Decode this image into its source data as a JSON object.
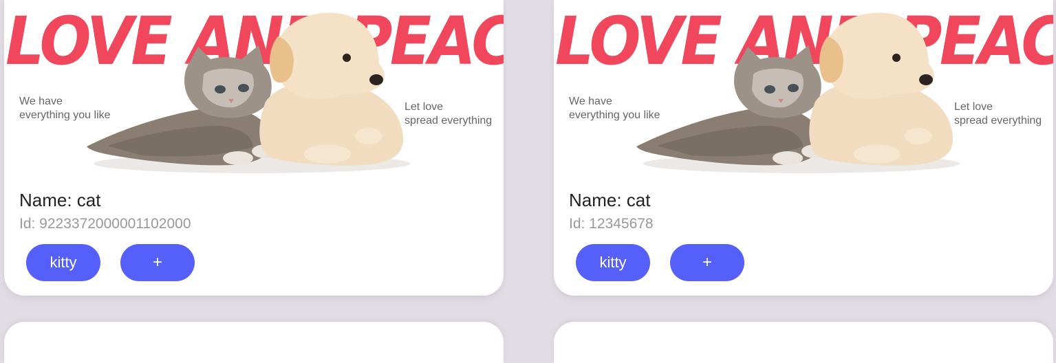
{
  "cards": [
    {
      "banner": {
        "headline": "LOVE AND PEACE",
        "caption_left_1": "We have",
        "caption_left_2": "everything you like",
        "caption_right_1": "Let love",
        "caption_right_2": "spread everything"
      },
      "name": "Name: cat",
      "id": "Id: 9223372000001102000",
      "tag_label": "kitty",
      "add_label": "+"
    },
    {
      "banner": {
        "headline": "LOVE AND PEACE",
        "caption_left_1": "We have",
        "caption_left_2": "everything you like",
        "caption_right_1": "Let love",
        "caption_right_2": "spread everything"
      },
      "name": "Name: cat",
      "id": "Id: 12345678",
      "tag_label": "kitty",
      "add_label": "+"
    }
  ],
  "colors": {
    "background": "#e2dde5",
    "card": "#ffffff",
    "headline": "#f0475c",
    "button": "#5560fa",
    "id_text": "#999999"
  }
}
